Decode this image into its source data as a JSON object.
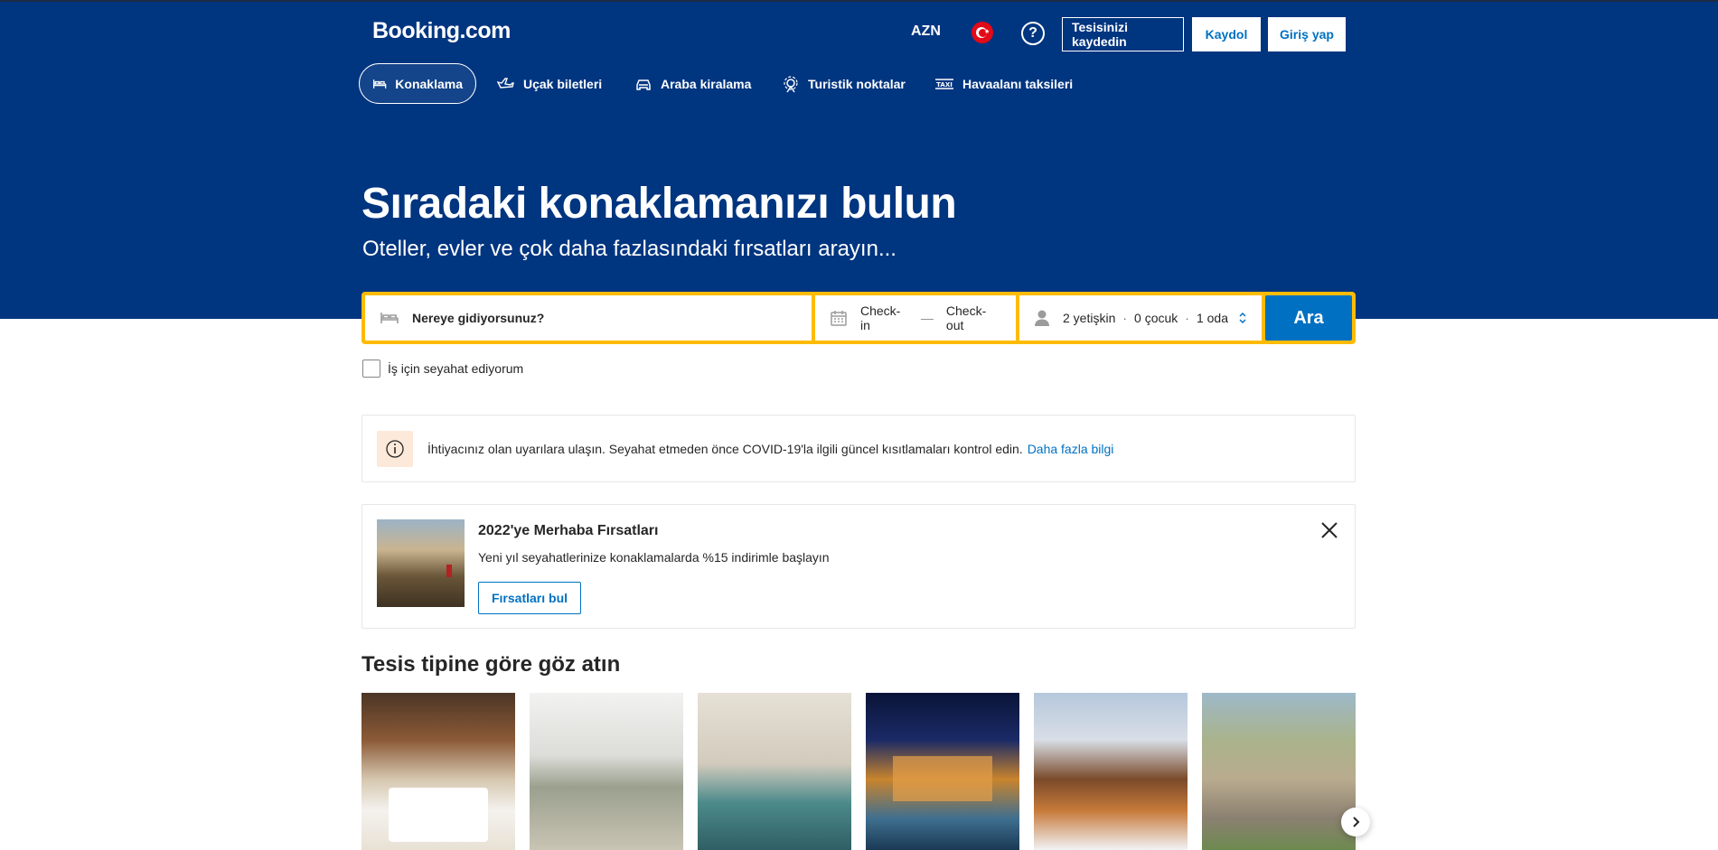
{
  "header": {
    "logo": "Booking.com",
    "currency": "AZN",
    "help": "?",
    "list_property": "Tesisinizi kaydedin",
    "register": "Kaydol",
    "sign_in": "Giriş yap"
  },
  "nav": {
    "items": [
      {
        "label": "Konaklama",
        "icon": "bed-icon",
        "active": true
      },
      {
        "label": "Uçak biletleri",
        "icon": "plane-icon",
        "active": false
      },
      {
        "label": "Araba kiralama",
        "icon": "car-icon",
        "active": false
      },
      {
        "label": "Turistik noktalar",
        "icon": "attractions-icon",
        "active": false
      },
      {
        "label": "Havaalanı taksileri",
        "icon": "taxi-icon",
        "active": false
      }
    ]
  },
  "hero": {
    "title": "Sıradaki konaklamanızı bulun",
    "subtitle": "Oteller, evler ve çok daha fazlasındaki fırsatları arayın..."
  },
  "search": {
    "destination_placeholder": "Nereye gidiyorsunuz?",
    "checkin": "Check-in",
    "dash": "—",
    "checkout": "Check-out",
    "adults": "2 yetişkin",
    "sep": "·",
    "children": "0 çocuk",
    "rooms": "1 oda",
    "button": "Ara"
  },
  "business_travel": {
    "label": "İş için seyahat ediyorum",
    "checked": false
  },
  "alert": {
    "text": "İhtiyacınız olan uyarılara ulaşın. Seyahat etmeden önce COVID-19'la ilgili güncel kısıtlamaları kontrol edin.",
    "link": "Daha fazla bilgi"
  },
  "promo": {
    "title": "2022'ye Merhaba Fırsatları",
    "description": "Yeni yıl seyahatlerinize konaklamalarda %15 indirimle başlayın",
    "button": "Fırsatları bul"
  },
  "property_types": {
    "title": "Tesis tipine göre göz atın",
    "cards": [
      "hotel-image",
      "apartment-image",
      "resort-image",
      "villa-image",
      "chalet-image",
      "cottage-image"
    ]
  },
  "colors": {
    "brand_blue": "#003580",
    "action_blue": "#0071c2",
    "search_yellow": "#febb02"
  }
}
